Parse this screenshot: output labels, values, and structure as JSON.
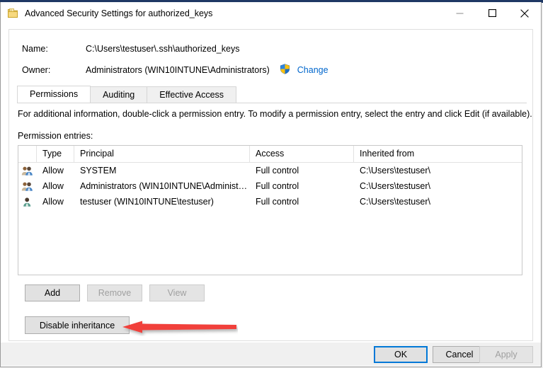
{
  "window": {
    "title": "Advanced Security Settings for authorized_keys",
    "icon": "folder-document-icon",
    "controls": {
      "minimize": "minimize-icon",
      "maximize": "maximize-icon",
      "close": "close-icon"
    }
  },
  "info": {
    "name_label": "Name:",
    "name_value": "C:\\Users\\testuser\\.ssh\\authorized_keys",
    "owner_label": "Owner:",
    "owner_value": "Administrators (WIN10INTUNE\\Administrators)",
    "change_link": "Change",
    "shield_icon": "uac-shield-icon"
  },
  "tabs": [
    {
      "label": "Permissions",
      "selected": true
    },
    {
      "label": "Auditing",
      "selected": false
    },
    {
      "label": "Effective Access",
      "selected": false
    }
  ],
  "instruction": "For additional information, double-click a permission entry. To modify a permission entry, select the entry and click Edit (if available).",
  "entries_label": "Permission entries:",
  "table": {
    "columns": [
      "",
      "Type",
      "Principal",
      "Access",
      "Inherited from"
    ],
    "rows": [
      {
        "icon": "group-icon",
        "type": "Allow",
        "principal": "SYSTEM",
        "access": "Full control",
        "inherited_from": "C:\\Users\\testuser\\"
      },
      {
        "icon": "group-icon",
        "type": "Allow",
        "principal": "Administrators (WIN10INTUNE\\Administrat...",
        "access": "Full control",
        "inherited_from": "C:\\Users\\testuser\\"
      },
      {
        "icon": "user-icon",
        "type": "Allow",
        "principal": "testuser (WIN10INTUNE\\testuser)",
        "access": "Full control",
        "inherited_from": "C:\\Users\\testuser\\"
      }
    ]
  },
  "actions": {
    "add": "Add",
    "remove": "Remove",
    "view": "View",
    "disable_inheritance": "Disable inheritance"
  },
  "footer": {
    "ok": "OK",
    "cancel": "Cancel",
    "apply": "Apply"
  },
  "annotation": {
    "type": "arrow-left",
    "color": "#f1403a",
    "points_to": "disable-inheritance-button"
  },
  "colors": {
    "link": "#0066cc",
    "focus_border": "#0078d7",
    "dialog_bg": "#f0f0f0",
    "annotation_red": "#f1403a"
  }
}
